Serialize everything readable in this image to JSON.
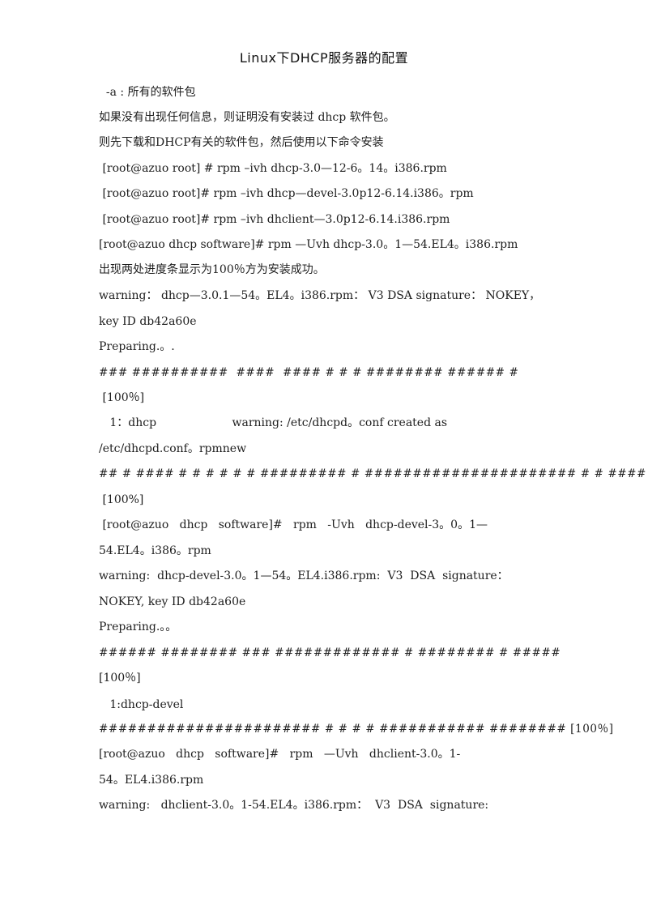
{
  "document": {
    "title": "Linux下DHCP服务器的配置",
    "lines": [
      "  -a : 所有的软件包",
      "如果没有出现任何信息，则证明没有安装过 dhcp 软件包。",
      "则先下载和DHCP有关的软件包，然后使用以下命令安装",
      " [root@azuo root] # rpm –ivh dhcp-3.0—12-6。14。i386.rpm",
      " [root@azuo root]# rpm –ivh dhcp—devel-3.0p12-6.14.i386。rpm",
      " [root@azuo root]# rpm –ivh dhclient—3.0p12-6.14.i386.rpm",
      "[root@azuo dhcp software]# rpm —Uvh dhcp-3.0。1—54.EL4。i386.rpm",
      "出现两处进度条显示为100％方为安装成功。",
      "warning： dhcp—3.0.1—54。EL4。i386.rpm： V3 DSA signature： NOKEY，",
      "key ID db42a60e",
      "Preparing.。.",
      "### ##########  ####  #### # # # ######## ###### #",
      " [100％]",
      "   1：dhcp                     warning: /etc/dhcpd。conf created as",
      "/etc/dhcpd.conf。rpmnew",
      "## # #### # # # # # # ######### # ###################### # # #### #",
      " [100%]",
      " [root@azuo   dhcp   software]#   rpm   -Uvh   dhcp-devel-3。0。1—",
      "54.EL4。i386。rpm",
      "warning:  dhcp-devel-3.0。1—54。EL4.i386.rpm:  V3  DSA  signature：",
      "NOKEY, key ID db42a60e",
      "Preparing.。。",
      "###### ######## ### ############# # ######## # #####",
      "[100％]",
      "   1:dhcp-devel",
      "####################### # # # # ########### ######## [100％]",
      "[root@azuo   dhcp   software]#   rpm   —Uvh   dhclient-3.0。1-",
      "54。EL4.i386.rpm",
      "warning:   dhclient-3.0。1-54.EL4。i386.rpm：  V3  DSA  signature:"
    ]
  }
}
